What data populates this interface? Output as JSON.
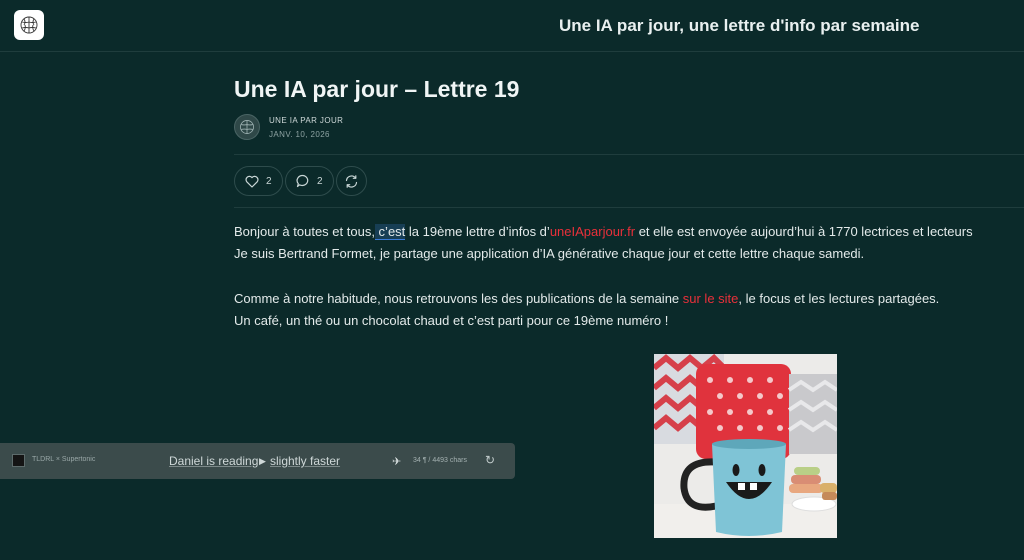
{
  "header": {
    "logo_icon": "brain-icon",
    "site_title": "Une IA par jour, une lettre d'info par semaine"
  },
  "post": {
    "title": "Une IA par jour – Lettre 19",
    "author": "UNE IA PAR JOUR",
    "date": "JANV. 10, 2026",
    "likes": "2",
    "comments": "2"
  },
  "body": {
    "p1_a": "Bonjour à toutes et tous,",
    "p1_b": " c’est",
    "p1_c": " la 19ème lettre d’infos d’",
    "p1_link": "uneIAparjour.fr",
    "p1_d": " et elle est envoyée aujourd’hui à 1770 lectrices et lecteurs",
    "p2": "Je suis Bertrand Formet, je partage une application d’IA générative chaque jour et cette lettre chaque samedi.",
    "p3_a": "Comme à notre habitude, nous retrouvons les des publications de la semaine ",
    "p3_link": "sur le site",
    "p3_b": ", le focus et les lectures partagées.",
    "p4": "Un café, un thé ou un chocolat chaud et c’est parti pour ce 19ème numéro !"
  },
  "player": {
    "brand": "TLDRL × Supertonic",
    "voice": "Daniel is reading",
    "speed": "slightly faster",
    "count": "34 ¶ / 4493 chars"
  },
  "colors": {
    "background": "#0b2a2a",
    "link": "#e8303a",
    "mug": "#7fc4d6"
  }
}
